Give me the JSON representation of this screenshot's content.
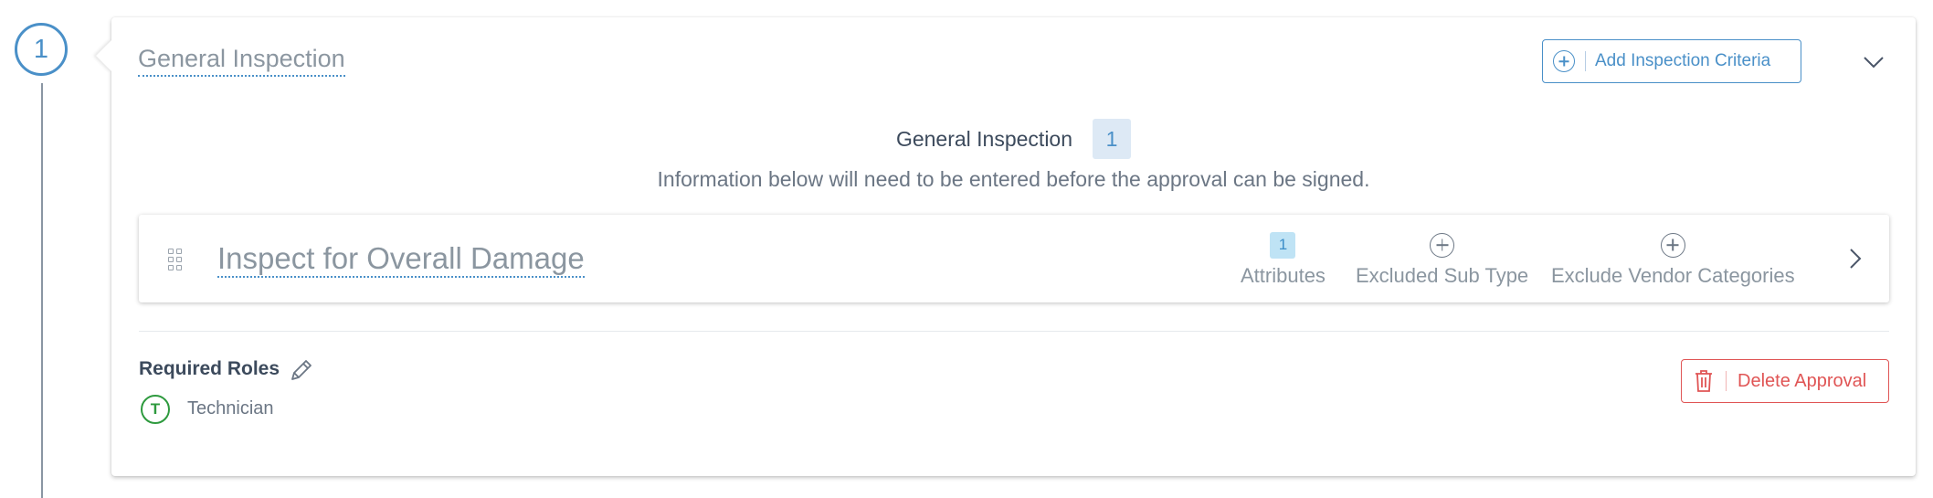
{
  "step": {
    "number": "1"
  },
  "approval": {
    "title": "General Inspection",
    "add_criteria_label": "Add Inspection Criteria",
    "section_name": "General Inspection",
    "criteria_count": "1",
    "info_text": "Information below will need to be entered before the approval can be signed."
  },
  "criteria": [
    {
      "title": "Inspect for Overall Damage",
      "attributes_count": "1",
      "attributes_label": "Attributes",
      "excluded_sub_type_label": "Excluded Sub Type",
      "exclude_vendor_label": "Exclude Vendor Categories"
    }
  ],
  "roles": {
    "label": "Required Roles",
    "items": [
      {
        "initial": "T",
        "name": "Technician"
      }
    ]
  },
  "actions": {
    "delete_label": "Delete Approval"
  },
  "colors": {
    "accent": "#4a90c8",
    "danger": "#e05555",
    "role_green": "#2e9a3e",
    "badge_bg": "#dde9f5"
  },
  "icons": [
    "plus-circle-icon",
    "chevron-down-icon",
    "drag-handle-icon",
    "chevron-right-icon",
    "pencil-icon",
    "trash-icon"
  ]
}
